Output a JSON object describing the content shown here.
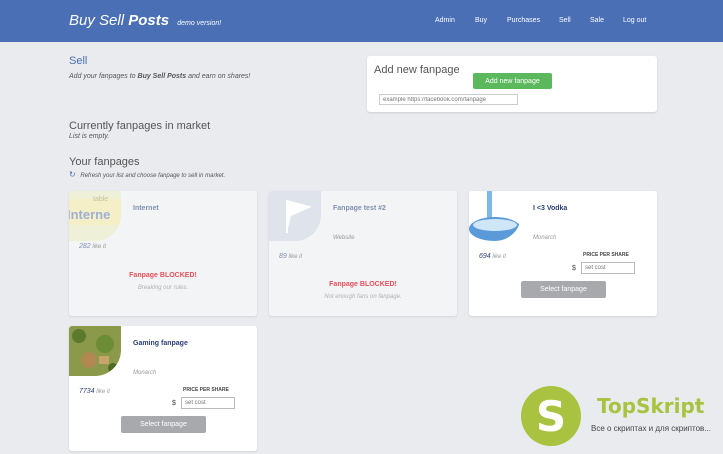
{
  "header": {
    "brand_part1": "Buy Sell",
    "brand_part2": "Posts",
    "brand_tag": "demo version!",
    "nav": [
      "Admin",
      "Buy",
      "Purchases",
      "Sell",
      "Sale",
      "Log out"
    ],
    "bg_color": "#4a6fb5"
  },
  "sell": {
    "title": "Sell",
    "subtitle_pre": "Add your fanpages to",
    "subtitle_brand": "Buy Sell Posts",
    "subtitle_post": "and earn on shares!"
  },
  "add_fanpage": {
    "title": "Add new fanpage",
    "button": "Add new fanpage",
    "placeholder": "example https://facebook.com/fanpage",
    "button_color": "#5cb85c"
  },
  "market": {
    "title": "Currently fanpages in market",
    "empty_text": "List is empty."
  },
  "your_fanpages": {
    "title": "Your fanpages",
    "refresh_text": "Refresh your list and choose fanpage to sell in market.",
    "refresh_icon": "refresh-icon"
  },
  "cards": [
    {
      "name": "Internet",
      "category": "",
      "likes": "282",
      "likes_suffix": "like it",
      "status": "Fanpage BLOCKED!",
      "reason": "Breaking our rules."
    },
    {
      "name": "Fanpage test #2",
      "category": "Website",
      "likes": "89",
      "likes_suffix": "like it",
      "status": "Fanpage BLOCKED!",
      "reason": "Not enough fans on fanpage."
    },
    {
      "name": "I <3 Vodka",
      "category": "Monarch",
      "likes": "694",
      "likes_suffix": "like it",
      "price_label": "PRICE PER SHARE",
      "currency": "$",
      "price_placeholder": "set cost",
      "select_button": "Select fanpage"
    },
    {
      "name": "Gaming fanpage",
      "category": "Monarch",
      "likes": "7734",
      "likes_suffix": "like it",
      "price_label": "PRICE PER SHARE",
      "currency": "$",
      "price_placeholder": "set cost",
      "select_button": "Select fanpage"
    }
  ],
  "watermark": {
    "logo_letter": "S",
    "name": "TopSkript",
    "tagline": "Все о скриптах и для скриптов...",
    "color": "#a9c23f"
  }
}
